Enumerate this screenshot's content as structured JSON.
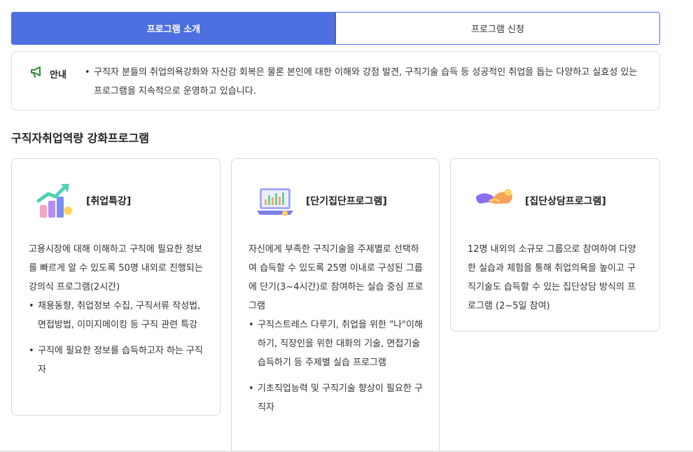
{
  "tabs": [
    {
      "label": "프로그램 소개",
      "active": true
    },
    {
      "label": "프로그램 신청",
      "active": false
    }
  ],
  "notice": {
    "label": "안내",
    "icon": "megaphone-icon",
    "text": "구직자 분들의 취업의욕강화와 자신감 회복은 물론 본인에 대한 이해와 강점 발견, 구직기술 습득 등 성공적인 취업을 돕는 다양하고 실효성 있는 프로그램을 지속적으로 운영하고 있습니다."
  },
  "section": {
    "title": "구직자취업역량 강화프로그램"
  },
  "colors": {
    "accent": "#4e6fe0",
    "border": "#d9d9d9"
  },
  "cards": [
    {
      "title": "[취업특강]",
      "icon": "growth-chart-icon",
      "description": "고용시장에 대해 이해하고 구직에 필요한 정보를 빠르게 알 수 있도록 50명 내외로 진행되는 강의식 프로그램(2시간)",
      "bullets": [
        "채용동향, 취업정보 수집, 구직서류 작성법, 면접방법, 이미지메이킹 등 구직 관련 특강",
        "구직에 필요한 정보를 습득하고자 하는 구직자"
      ]
    },
    {
      "title": "[단기집단프로그램]",
      "icon": "laptop-chart-icon",
      "description": "자신에게 부족한 구직기술을 주제별로 선택하여 습득할 수 있도록 25명 이내로 구성된 그룹에 단기(3~4시간)로 참여하는 실습 중심 프로그램",
      "bullets": [
        "구직스트레스 다루기, 취업을 위한 \"나\"이해하기, 직장인을 위한 대화의 기술, 면접기술 습득하기 등 주제별 실습 프로그램",
        "기초직업능력 및 구직기술 향상이 필요한 구직자"
      ]
    },
    {
      "title": "[집단상담프로그램]",
      "icon": "handshake-icon",
      "description": "12명 내외의 소규모 그룹으로 참여하여 다양한 실습과 체험을 통해 취업의욕을 높이고 구직기술도 습득할 수 있는 집단상담 방식의 프로그램 (2~5일 참여)",
      "bullets": []
    }
  ]
}
